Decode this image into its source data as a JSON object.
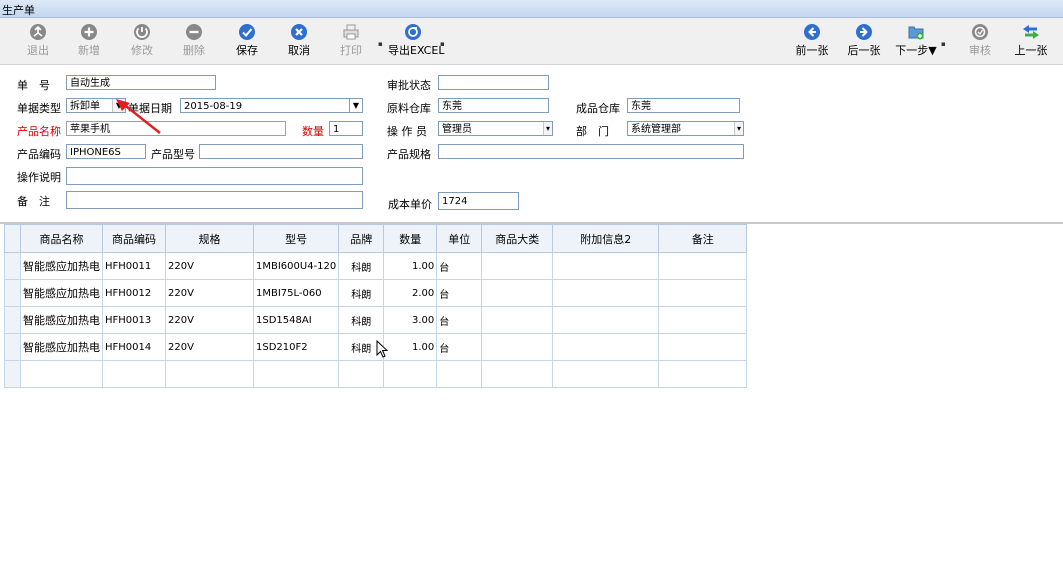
{
  "window": {
    "title": "生产单"
  },
  "toolbar": {
    "items": [
      {
        "label": "退出",
        "icon": "exit-icon",
        "enabled": false
      },
      {
        "label": "新增",
        "icon": "add-icon",
        "enabled": false
      },
      {
        "label": "修改",
        "icon": "edit-icon",
        "enabled": false
      },
      {
        "label": "删除",
        "icon": "delete-icon",
        "enabled": false
      },
      {
        "label": "保存",
        "icon": "save-icon",
        "enabled": true
      },
      {
        "label": "取消",
        "icon": "cancel-icon",
        "enabled": true
      },
      {
        "label": "打印",
        "icon": "print-icon",
        "enabled": false
      },
      {
        "label": "导出EXCEL",
        "icon": "export-excel-icon",
        "enabled": true
      }
    ],
    "right_items": [
      {
        "label": "前一张",
        "icon": "prev-icon",
        "enabled": true
      },
      {
        "label": "后一张",
        "icon": "next-icon",
        "enabled": true
      },
      {
        "label": "下一步▼",
        "icon": "next-step-icon",
        "enabled": true
      },
      {
        "label": "审核",
        "icon": "audit-icon",
        "enabled": false
      },
      {
        "label": "上一张",
        "icon": "previous-icon",
        "enabled": true
      }
    ]
  },
  "form": {
    "order_no_label": "单　号",
    "order_no": "自动生成",
    "doc_type_label": "单据类型",
    "doc_type": "拆卸单",
    "doc_date_label": "单据日期",
    "doc_date": "2015-08-19",
    "product_name_label": "产品名称",
    "product_name": "苹果手机",
    "qty_label": "数量",
    "qty": "1",
    "product_code_label": "产品编码",
    "product_code": "IPHONE6S",
    "product_model_label": "产品型号",
    "product_model": "",
    "operation_note_label": "操作说明",
    "operation_note": "",
    "remark_label": "备　注",
    "remark": "",
    "approval_status_label": "审批状态",
    "approval_status": "",
    "raw_warehouse_label": "原料仓库",
    "raw_warehouse": "东莞",
    "finished_warehouse_label": "成品仓库",
    "finished_warehouse": "东莞",
    "operator_label": "操 作 员",
    "operator": "管理员",
    "department_label": "部　门",
    "department": "系统管理部",
    "product_spec_label": "产品规格",
    "product_spec": "",
    "unit_cost_label": "成本单价",
    "unit_cost": "1724"
  },
  "grid": {
    "columns": [
      "商品名称",
      "商品编码",
      "规格",
      "型号",
      "品牌",
      "数量",
      "单位",
      "商品大类",
      "附加信息2",
      "备注"
    ],
    "rows": [
      [
        "智能感应加热电",
        "HFH0011",
        "220V",
        "1MBI600U4-120",
        "科朗",
        "1.00",
        "台",
        "",
        "",
        ""
      ],
      [
        "智能感应加热电",
        "HFH0012",
        "220V",
        "1MBI75L-060",
        "科朗",
        "2.00",
        "台",
        "",
        "",
        ""
      ],
      [
        "智能感应加热电",
        "HFH0013",
        "220V",
        "1SD1548AI",
        "科朗",
        "3.00",
        "台",
        "",
        "",
        ""
      ],
      [
        "智能感应加热电",
        "HFH0014",
        "220V",
        "1SD210F2",
        "科朗",
        "1.00",
        "台",
        "",
        "",
        ""
      ],
      [
        "",
        "",
        "",
        "",
        "",
        "",
        "",
        "",
        "",
        ""
      ]
    ]
  },
  "colors": {
    "accent_red": "#e00000",
    "grid_border": "#c4d6ea",
    "header_bg": "#eef3fa"
  }
}
